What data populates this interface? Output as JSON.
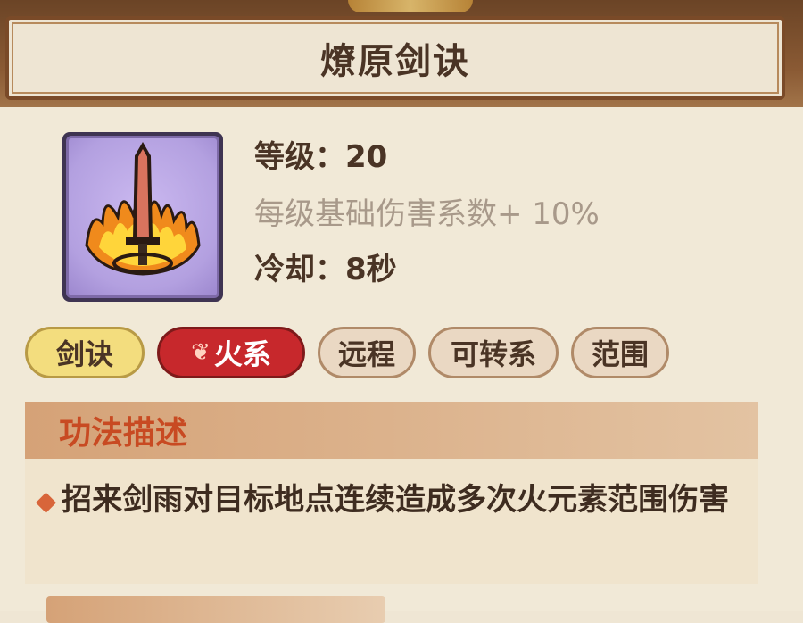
{
  "skill": {
    "name": "燎原剑诀",
    "level_text": "等级：20",
    "coefficient_text": "每级基础伤害系数+ 10%",
    "cooldown_text": "冷却：8秒"
  },
  "tags": {
    "sword": "剑诀",
    "fire": "火系",
    "ranged": "远程",
    "switchable": "可转系",
    "area": "范围"
  },
  "description": {
    "header": "功法描述",
    "text": "招来剑雨对目标地点连续造成多次火元素范围伤害"
  },
  "colors": {
    "title_text": "#4a3425",
    "fire_tag": "#c7282c",
    "sword_tag": "#f3dd7e",
    "description_header": "#c84a22",
    "icon_background": "#b3a0e0"
  },
  "icons": {
    "skill_icon": "flaming-sword-icon",
    "fire_element": "flame-icon",
    "bullet": "diamond-bullet-icon"
  }
}
